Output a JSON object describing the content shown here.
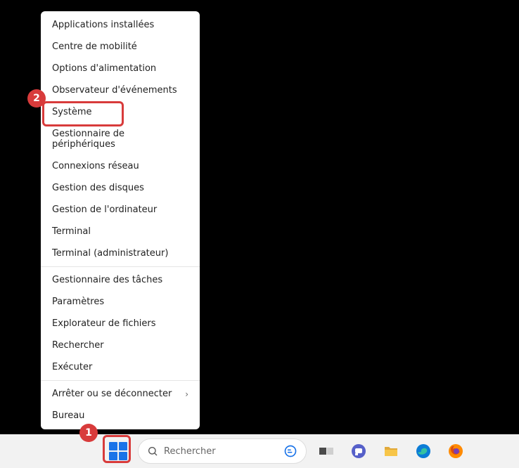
{
  "callouts": {
    "one": "1",
    "two": "2"
  },
  "menu": {
    "groups": [
      [
        "Applications installées",
        "Centre de mobilité",
        "Options d'alimentation",
        "Observateur d'événements",
        "Système",
        "Gestionnaire de périphériques",
        "Connexions réseau",
        "Gestion des disques",
        "Gestion de l'ordinateur",
        "Terminal",
        "Terminal (administrateur)"
      ],
      [
        "Gestionnaire des tâches",
        "Paramètres",
        "Explorateur de fichiers",
        "Rechercher",
        "Exécuter"
      ],
      [
        "Arrêter ou se déconnecter",
        "Bureau"
      ]
    ],
    "submenu_index": {
      "group": 2,
      "item": 0
    }
  },
  "taskbar": {
    "search_placeholder": "Rechercher",
    "icons": [
      "taskview",
      "chat",
      "explorer",
      "edge",
      "firefox"
    ]
  }
}
